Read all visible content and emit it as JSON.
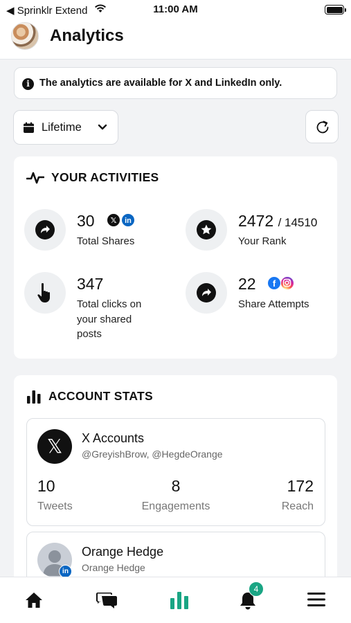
{
  "status_bar": {
    "back_label": "◀ Sprinklr Extend",
    "time": "11:00 AM"
  },
  "header": {
    "title": "Analytics"
  },
  "info_banner": {
    "text": "The analytics are available for X and LinkedIn only."
  },
  "period": {
    "selected": "Lifetime"
  },
  "activities": {
    "title": "YOUR ACTIVITIES",
    "total_shares": {
      "value": "30",
      "label": "Total Shares"
    },
    "rank": {
      "value": "2472",
      "suffix": "/ 14510",
      "label": "Your Rank"
    },
    "clicks": {
      "value": "347",
      "label_lines": [
        "Total clicks on",
        "your shared",
        "posts"
      ]
    },
    "share_attempts": {
      "value": "22",
      "label": "Share Attempts"
    }
  },
  "account_stats": {
    "title": "ACCOUNT STATS",
    "x_account": {
      "name": "X Accounts",
      "handles": "@GreyishBrow, @HegdeOrange",
      "stats": [
        {
          "value": "10",
          "label": "Tweets"
        },
        {
          "value": "8",
          "label": "Engagements"
        },
        {
          "value": "172",
          "label": "Reach"
        }
      ]
    },
    "linkedin_account": {
      "name": "Orange Hedge",
      "subtitle": "Orange Hedge"
    }
  },
  "tab_bar": {
    "tabs": [
      "home",
      "messages",
      "analytics",
      "notifications",
      "menu"
    ],
    "active_tab": "analytics",
    "notification_count": "4"
  },
  "colors": {
    "accent": "#1aa584",
    "linkedin": "#0a66c2",
    "facebook": "#1877f2",
    "text": "#111111",
    "muted": "#777777"
  }
}
